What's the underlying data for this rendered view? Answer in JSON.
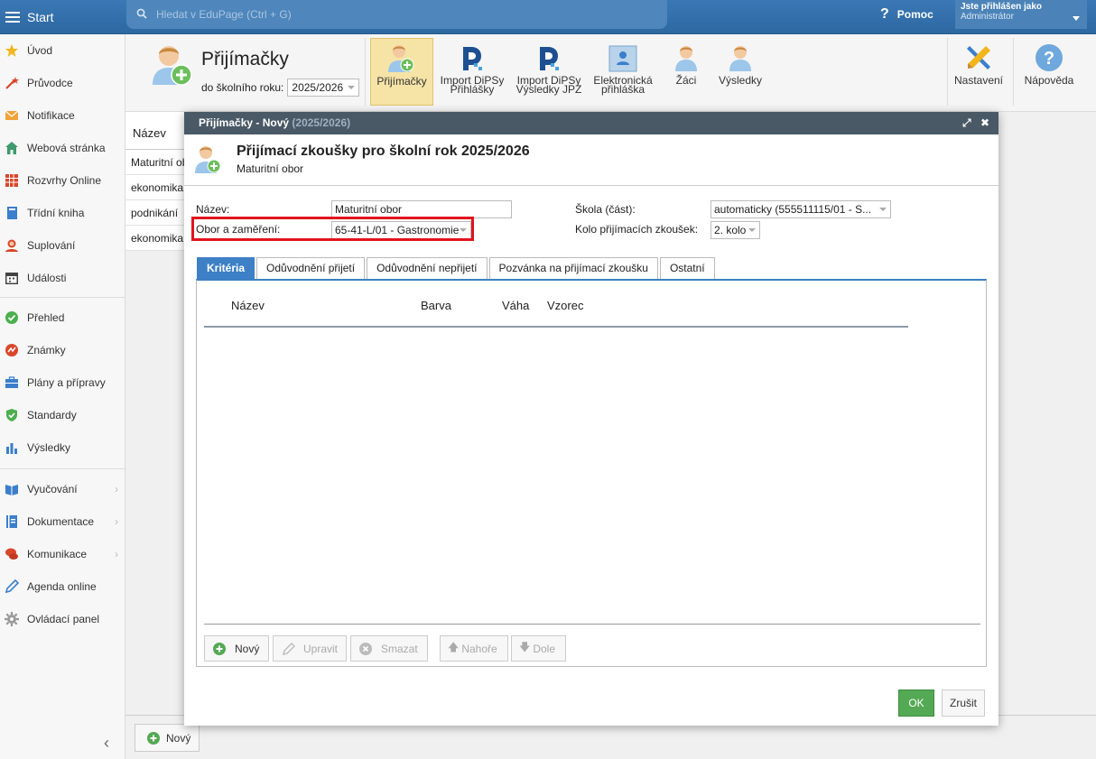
{
  "topbar": {
    "start_label": "Start",
    "search_placeholder": "Hledat v EduPage (Ctrl + G)",
    "help_label": "Pomoc",
    "user_line1": "Jste přihlášen jako",
    "user_line2": "Administrátor"
  },
  "sidebar": {
    "items": [
      {
        "label": "Úvod",
        "icon": "star-icon"
      },
      {
        "label": "Průvodce",
        "icon": "wand-icon"
      },
      {
        "label": "Notifikace",
        "icon": "envelope-icon"
      },
      {
        "label": "Webová stránka",
        "icon": "house-icon"
      },
      {
        "label": "Rozvrhy Online",
        "icon": "timetable-icon"
      },
      {
        "label": "Třídní kniha",
        "icon": "book-icon"
      },
      {
        "label": "Suplování",
        "icon": "person-icon"
      },
      {
        "label": "Události",
        "icon": "calendar-icon"
      },
      {
        "label": "Přehled",
        "icon": "check-circle-icon"
      },
      {
        "label": "Známky",
        "icon": "grades-icon"
      },
      {
        "label": "Plány a přípravy",
        "icon": "briefcase-icon"
      },
      {
        "label": "Standardy",
        "icon": "shield-icon"
      },
      {
        "label": "Výsledky",
        "icon": "bar-chart-icon"
      },
      {
        "label": "Vyučování",
        "icon": "open-book-icon"
      },
      {
        "label": "Dokumentace",
        "icon": "document-icon"
      },
      {
        "label": "Komunikace",
        "icon": "chat-icon"
      },
      {
        "label": "Agenda online",
        "icon": "pen-icon"
      },
      {
        "label": "Ovládací panel",
        "icon": "gear-icon"
      }
    ]
  },
  "module": {
    "title": "Přijímačky",
    "year_label": "do školního roku:",
    "year_value": "2025/2026",
    "toolbar": {
      "prijimacky": "Přijímačky",
      "import_dipsy_1a": "Import DiPSy",
      "import_dipsy_1b": "Přihlášky",
      "import_dipsy_2a": "Import DiPSy",
      "import_dipsy_2b": "Výsledky JPZ",
      "elektronicka_a": "Elektronická",
      "elektronicka_b": "přihláška",
      "zaci": "Žáci",
      "vysledky": "Výsledky",
      "nastaveni": "Nastavení",
      "napoveda": "Nápověda"
    }
  },
  "bglist": {
    "header": "Název",
    "rows": [
      "Maturitní obor",
      "ekonomika",
      "podnikání",
      "ekonomika"
    ],
    "new_button": "Nový"
  },
  "modal": {
    "title": "Přijímačky - Nový",
    "title_year": "(2025/2026)",
    "heading": "Přijímací zkoušky pro školní rok 2025/2026",
    "subheading": "Maturitní obor",
    "fields": {
      "nazev_label": "Název:",
      "nazev_value": "Maturitní obor",
      "obor_label": "Obor a zaměření:",
      "obor_value": "65-41-L/01 - Gastronomie",
      "skola_label": "Škola (část):",
      "skola_value": "automaticky (555511115/01 - S...",
      "kolo_label": "Kolo přijímacích zkoušek:",
      "kolo_value": "2. kolo"
    },
    "tabs": [
      "Kritéria",
      "Odůvodnění přijetí",
      "Odůvodnění nepřijetí",
      "Pozvánka na přijímací zkoušku",
      "Ostatní"
    ],
    "grid_columns": [
      "Název",
      "Barva",
      "Váha",
      "Vzorec"
    ],
    "panel_buttons": {
      "new": "Nový",
      "edit": "Upravit",
      "delete": "Smazat",
      "up": "Nahoře",
      "down": "Dole"
    },
    "ok": "OK",
    "cancel": "Zrušit"
  },
  "colors": {
    "topbar": "#2e6da4",
    "accent_tab": "#3d80c5",
    "ok_green": "#54a954",
    "highlight_red": "#e0141e",
    "active_toolbar": "#f6e3a6"
  }
}
